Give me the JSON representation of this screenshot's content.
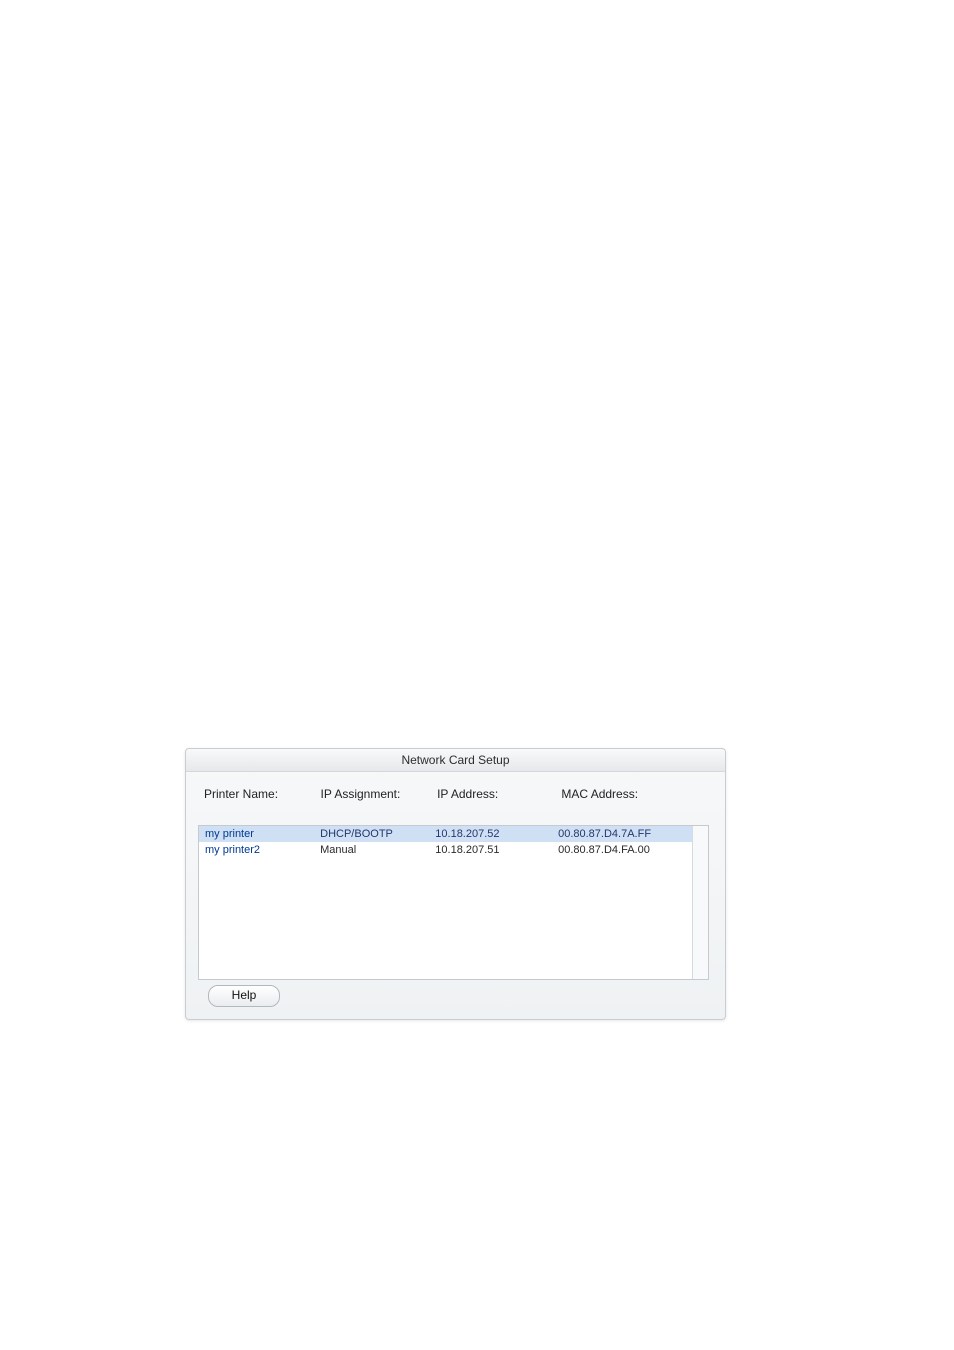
{
  "window": {
    "title": "Network Card Setup"
  },
  "columns": {
    "name": "Printer Name:",
    "assign": "IP Assignment:",
    "ip": "IP Address:",
    "mac": "MAC Address:"
  },
  "rows": [
    {
      "name": "my printer",
      "assign": "DHCP/BOOTP",
      "ip": "10.18.207.52",
      "mac": "00.80.87.D4.7A.FF",
      "selected": true
    },
    {
      "name": "my printer2",
      "assign": "Manual",
      "ip": "10.18.207.51",
      "mac": "00.80.87.D4.FA.00",
      "selected": false
    }
  ],
  "buttons": {
    "help": "Help"
  }
}
